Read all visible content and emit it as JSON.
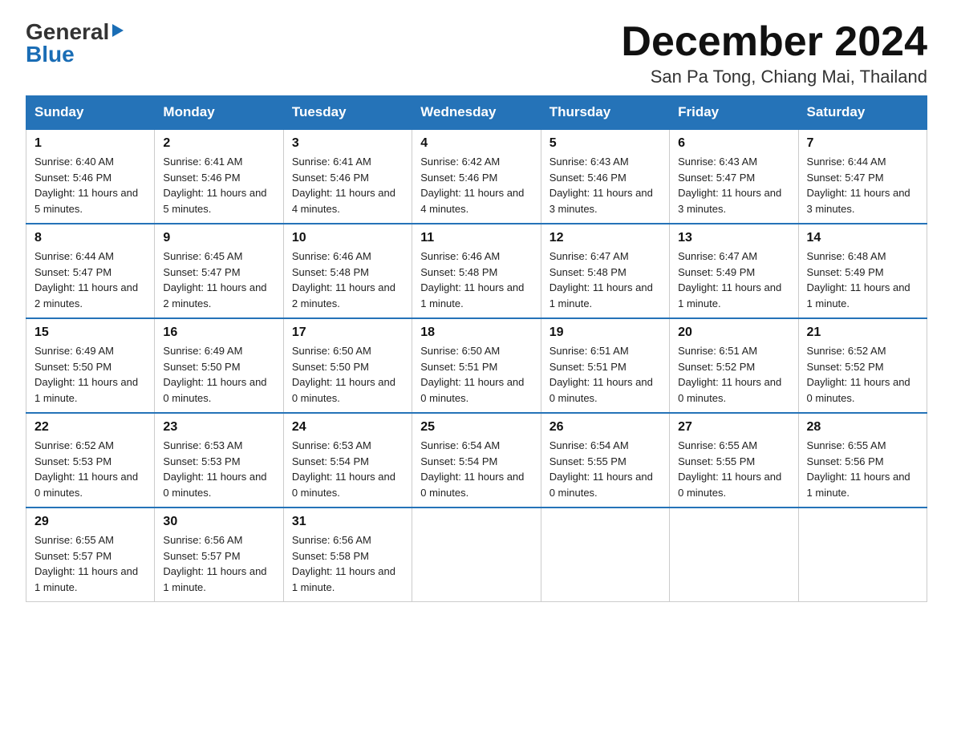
{
  "logo": {
    "general": "General",
    "triangle": "▶",
    "blue": "Blue"
  },
  "header": {
    "month": "December 2024",
    "location": "San Pa Tong, Chiang Mai, Thailand"
  },
  "days": [
    "Sunday",
    "Monday",
    "Tuesday",
    "Wednesday",
    "Thursday",
    "Friday",
    "Saturday"
  ],
  "weeks": [
    [
      {
        "day": "1",
        "sunrise": "6:40 AM",
        "sunset": "5:46 PM",
        "daylight": "11 hours and 5 minutes."
      },
      {
        "day": "2",
        "sunrise": "6:41 AM",
        "sunset": "5:46 PM",
        "daylight": "11 hours and 5 minutes."
      },
      {
        "day": "3",
        "sunrise": "6:41 AM",
        "sunset": "5:46 PM",
        "daylight": "11 hours and 4 minutes."
      },
      {
        "day": "4",
        "sunrise": "6:42 AM",
        "sunset": "5:46 PM",
        "daylight": "11 hours and 4 minutes."
      },
      {
        "day": "5",
        "sunrise": "6:43 AM",
        "sunset": "5:46 PM",
        "daylight": "11 hours and 3 minutes."
      },
      {
        "day": "6",
        "sunrise": "6:43 AM",
        "sunset": "5:47 PM",
        "daylight": "11 hours and 3 minutes."
      },
      {
        "day": "7",
        "sunrise": "6:44 AM",
        "sunset": "5:47 PM",
        "daylight": "11 hours and 3 minutes."
      }
    ],
    [
      {
        "day": "8",
        "sunrise": "6:44 AM",
        "sunset": "5:47 PM",
        "daylight": "11 hours and 2 minutes."
      },
      {
        "day": "9",
        "sunrise": "6:45 AM",
        "sunset": "5:47 PM",
        "daylight": "11 hours and 2 minutes."
      },
      {
        "day": "10",
        "sunrise": "6:46 AM",
        "sunset": "5:48 PM",
        "daylight": "11 hours and 2 minutes."
      },
      {
        "day": "11",
        "sunrise": "6:46 AM",
        "sunset": "5:48 PM",
        "daylight": "11 hours and 1 minute."
      },
      {
        "day": "12",
        "sunrise": "6:47 AM",
        "sunset": "5:48 PM",
        "daylight": "11 hours and 1 minute."
      },
      {
        "day": "13",
        "sunrise": "6:47 AM",
        "sunset": "5:49 PM",
        "daylight": "11 hours and 1 minute."
      },
      {
        "day": "14",
        "sunrise": "6:48 AM",
        "sunset": "5:49 PM",
        "daylight": "11 hours and 1 minute."
      }
    ],
    [
      {
        "day": "15",
        "sunrise": "6:49 AM",
        "sunset": "5:50 PM",
        "daylight": "11 hours and 1 minute."
      },
      {
        "day": "16",
        "sunrise": "6:49 AM",
        "sunset": "5:50 PM",
        "daylight": "11 hours and 0 minutes."
      },
      {
        "day": "17",
        "sunrise": "6:50 AM",
        "sunset": "5:50 PM",
        "daylight": "11 hours and 0 minutes."
      },
      {
        "day": "18",
        "sunrise": "6:50 AM",
        "sunset": "5:51 PM",
        "daylight": "11 hours and 0 minutes."
      },
      {
        "day": "19",
        "sunrise": "6:51 AM",
        "sunset": "5:51 PM",
        "daylight": "11 hours and 0 minutes."
      },
      {
        "day": "20",
        "sunrise": "6:51 AM",
        "sunset": "5:52 PM",
        "daylight": "11 hours and 0 minutes."
      },
      {
        "day": "21",
        "sunrise": "6:52 AM",
        "sunset": "5:52 PM",
        "daylight": "11 hours and 0 minutes."
      }
    ],
    [
      {
        "day": "22",
        "sunrise": "6:52 AM",
        "sunset": "5:53 PM",
        "daylight": "11 hours and 0 minutes."
      },
      {
        "day": "23",
        "sunrise": "6:53 AM",
        "sunset": "5:53 PM",
        "daylight": "11 hours and 0 minutes."
      },
      {
        "day": "24",
        "sunrise": "6:53 AM",
        "sunset": "5:54 PM",
        "daylight": "11 hours and 0 minutes."
      },
      {
        "day": "25",
        "sunrise": "6:54 AM",
        "sunset": "5:54 PM",
        "daylight": "11 hours and 0 minutes."
      },
      {
        "day": "26",
        "sunrise": "6:54 AM",
        "sunset": "5:55 PM",
        "daylight": "11 hours and 0 minutes."
      },
      {
        "day": "27",
        "sunrise": "6:55 AM",
        "sunset": "5:55 PM",
        "daylight": "11 hours and 0 minutes."
      },
      {
        "day": "28",
        "sunrise": "6:55 AM",
        "sunset": "5:56 PM",
        "daylight": "11 hours and 1 minute."
      }
    ],
    [
      {
        "day": "29",
        "sunrise": "6:55 AM",
        "sunset": "5:57 PM",
        "daylight": "11 hours and 1 minute."
      },
      {
        "day": "30",
        "sunrise": "6:56 AM",
        "sunset": "5:57 PM",
        "daylight": "11 hours and 1 minute."
      },
      {
        "day": "31",
        "sunrise": "6:56 AM",
        "sunset": "5:58 PM",
        "daylight": "11 hours and 1 minute."
      },
      null,
      null,
      null,
      null
    ]
  ]
}
